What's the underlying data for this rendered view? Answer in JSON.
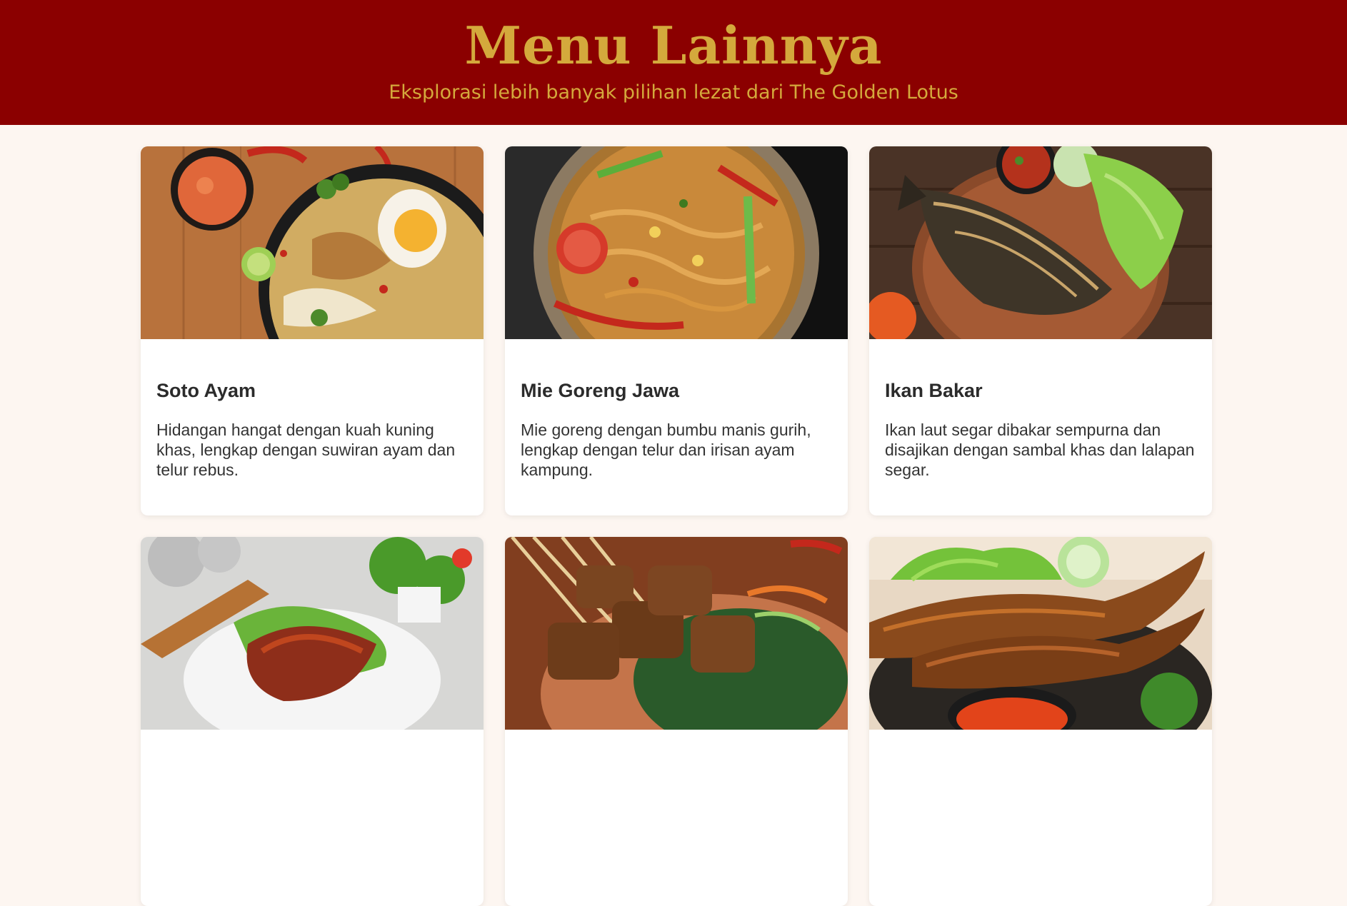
{
  "header": {
    "title": "Menu Lainnya",
    "subtitle": "Eksplorasi lebih banyak pilihan lezat dari The Golden Lotus"
  },
  "colors": {
    "header_bg": "#8b0000",
    "accent_gold": "#d4a93c",
    "page_bg": "#fdf6f1",
    "card_bg": "#ffffff"
  },
  "menu": [
    {
      "title": "Soto Ayam",
      "description": "Hidangan hangat dengan kuah kuning khas, lengkap dengan suwiran ayam dan telur rebus.",
      "image": "soto-ayam-photo"
    },
    {
      "title": "Mie Goreng Jawa",
      "description": "Mie goreng dengan bumbu manis gurih, lengkap dengan telur dan irisan ayam kampung.",
      "image": "mie-goreng-photo"
    },
    {
      "title": "Ikan Bakar",
      "description": "Ikan laut segar dibakar sempurna dan disajikan dengan sambal khas dan lalapan segar.",
      "image": "ikan-bakar-photo"
    },
    {
      "title": "",
      "description": "",
      "image": "ayam-bakar-photo"
    },
    {
      "title": "",
      "description": "",
      "image": "sate-photo"
    },
    {
      "title": "",
      "description": "",
      "image": "lele-goreng-photo"
    }
  ]
}
